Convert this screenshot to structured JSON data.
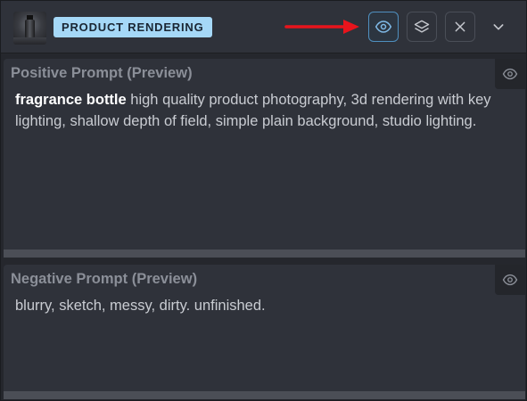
{
  "header": {
    "badge_label": "PRODUCT RENDERING",
    "buttons": [
      {
        "name": "preview",
        "icon": "eye-icon",
        "active": true
      },
      {
        "name": "layers",
        "icon": "layers-icon",
        "active": false
      },
      {
        "name": "close",
        "icon": "close-icon",
        "active": false
      },
      {
        "name": "collapse",
        "icon": "chevron-down-icon",
        "active": false
      }
    ]
  },
  "positive": {
    "title": "Positive Prompt (Preview)",
    "highlight": "fragrance bottle",
    "text": " high quality product photography, 3d rendering with key lighting, shallow depth of field, simple plain background, studio lighting."
  },
  "negative": {
    "title": "Negative Prompt (Preview)",
    "text": "blurry, sketch, messy, dirty. unfinished."
  },
  "colors": {
    "accent": "#a5d8f7",
    "arrow": "#e8141c",
    "active_border": "#4f8fbf"
  }
}
